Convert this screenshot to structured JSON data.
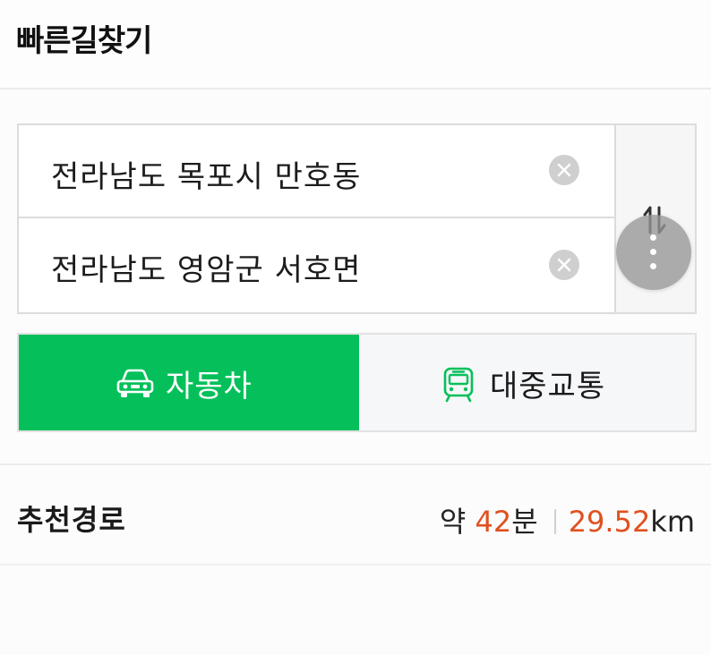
{
  "header": {
    "title": "빠른길찾기"
  },
  "route": {
    "origin": "전라남도 목포시 만호동",
    "destination": "전라남도 영암군 서호면"
  },
  "icons": {
    "clear": "clear-circle-icon",
    "swap": "swap-vertical-icon",
    "more": "more-vertical-icon",
    "car": "car-icon",
    "transit": "bus-icon"
  },
  "modes": {
    "car_label": "자동차",
    "transit_label": "대중교통"
  },
  "result": {
    "title": "추천경로",
    "time_prefix": "약 ",
    "time_value": "42",
    "time_unit": "분",
    "distance_value": "29.52",
    "distance_unit": "km"
  },
  "colors": {
    "accent_green": "#05c05a",
    "highlight_orange": "#e0501f"
  }
}
